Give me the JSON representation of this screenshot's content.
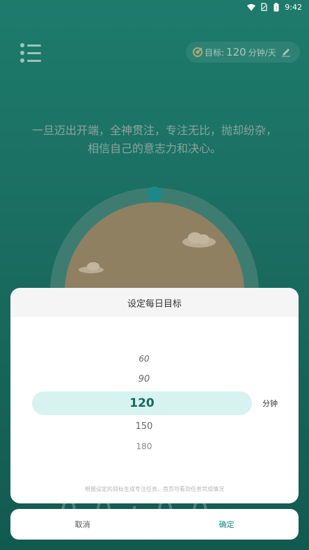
{
  "status_bar": {
    "time": "9:42"
  },
  "header": {
    "goal_label": "目标:",
    "goal_value": "120",
    "goal_unit": "分钟/天"
  },
  "motto": "一旦迈出开端，全神贯注，专注无比，抛却纷杂，相信自己的意志力和决心。",
  "dialog": {
    "title": "设定每日目标",
    "picker_options": [
      "60",
      "90",
      "120",
      "150",
      "180"
    ],
    "selected": "120",
    "unit": "分钟",
    "hint": "根据设定的目标生成专注任务，首页可看到任务完成情况"
  },
  "actions": {
    "cancel": "取消",
    "confirm": "确定"
  },
  "colors": {
    "background": "#1b6f62",
    "accent": "#1a8a7f",
    "selected_highlight": "#d6f3ef"
  },
  "icons": [
    "wifi-icon",
    "sim-icon",
    "battery-icon",
    "menu-icon",
    "target-icon",
    "edit-icon"
  ]
}
